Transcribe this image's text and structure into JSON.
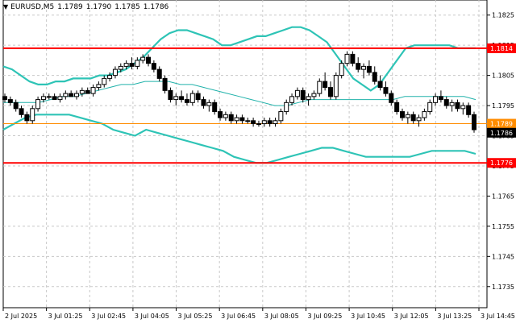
{
  "header": {
    "symbol": "EURUSD,M5",
    "bid_open": "1.1789",
    "bid_high": "1.1790",
    "bid_low": "1.1785",
    "bid_close": "1.1786"
  },
  "colors": {
    "background": "#ffffff",
    "candle": "#000000",
    "bands": "#2ec4b6",
    "ma": "#20b2aa",
    "resistance": "#ff0000",
    "support": "#ff0000",
    "marker": "#ff8c00",
    "grid": "#c8c8c8",
    "price_tag_dark": "#000000"
  },
  "chart_data": {
    "type": "candlestick",
    "ylim": [
      1.1728,
      1.183
    ],
    "y_ticks": [
      "1.1825",
      "1.1815",
      "1.1805",
      "1.1795",
      "1.1785",
      "1.1775",
      "1.1765",
      "1.1755",
      "1.1745",
      "1.1735"
    ],
    "x_labels": [
      "2 Jul 2025",
      "3 Jul 01:25",
      "3 Jul 02:45",
      "3 Jul 04:05",
      "3 Jul 05:25",
      "3 Jul 06:45",
      "3 Jul 08:05",
      "3 Jul 09:25",
      "3 Jul 10:45",
      "3 Jul 12:05",
      "3 Jul 13:25",
      "3 Jul 14:45"
    ],
    "grid": true,
    "levels": [
      {
        "name": "resistance",
        "value": 1.1814,
        "label": "1.1814",
        "color": "#ff0000"
      },
      {
        "name": "marker",
        "value": 1.1789,
        "label": "1.1789",
        "color": "#ff8c00"
      },
      {
        "name": "support",
        "value": 1.1776,
        "label": "1.1776",
        "color": "#ff0000"
      }
    ],
    "current_price": {
      "value": 1.1786,
      "label": "1.1786"
    },
    "candles": [
      [
        1.1798,
        1.1799,
        1.1796,
        1.1797
      ],
      [
        1.1797,
        1.1798,
        1.1795,
        1.1796
      ],
      [
        1.1796,
        1.1797,
        1.1793,
        1.1794
      ],
      [
        1.1794,
        1.1795,
        1.1791,
        1.1792
      ],
      [
        1.1792,
        1.1793,
        1.1789,
        1.179
      ],
      [
        1.179,
        1.1795,
        1.1789,
        1.1794
      ],
      [
        1.1794,
        1.1798,
        1.1793,
        1.1797
      ],
      [
        1.1797,
        1.1799,
        1.1796,
        1.1798
      ],
      [
        1.1798,
        1.1799,
        1.1797,
        1.1798
      ],
      [
        1.1798,
        1.1799,
        1.1797,
        1.1797
      ],
      [
        1.1797,
        1.1799,
        1.1796,
        1.1798
      ],
      [
        1.1798,
        1.18,
        1.1797,
        1.1799
      ],
      [
        1.1799,
        1.18,
        1.1798,
        1.1798
      ],
      [
        1.1798,
        1.18,
        1.1797,
        1.1799
      ],
      [
        1.1799,
        1.1801,
        1.1798,
        1.18
      ],
      [
        1.18,
        1.1801,
        1.1799,
        1.1799
      ],
      [
        1.1799,
        1.1802,
        1.1798,
        1.1801
      ],
      [
        1.1801,
        1.1803,
        1.18,
        1.1802
      ],
      [
        1.1802,
        1.1805,
        1.1801,
        1.1804
      ],
      [
        1.1804,
        1.1806,
        1.1803,
        1.1805
      ],
      [
        1.1805,
        1.1808,
        1.1804,
        1.1807
      ],
      [
        1.1807,
        1.1809,
        1.1806,
        1.1808
      ],
      [
        1.1808,
        1.181,
        1.1807,
        1.1809
      ],
      [
        1.1809,
        1.1811,
        1.1807,
        1.1808
      ],
      [
        1.1808,
        1.1811,
        1.1807,
        1.181
      ],
      [
        1.181,
        1.1812,
        1.1809,
        1.1811
      ],
      [
        1.1811,
        1.1812,
        1.1808,
        1.1809
      ],
      [
        1.1809,
        1.181,
        1.1806,
        1.1807
      ],
      [
        1.1807,
        1.1808,
        1.1803,
        1.1804
      ],
      [
        1.1804,
        1.1805,
        1.1799,
        1.18
      ],
      [
        1.18,
        1.1801,
        1.1796,
        1.1797
      ],
      [
        1.1797,
        1.1799,
        1.1795,
        1.1798
      ],
      [
        1.1798,
        1.18,
        1.1796,
        1.1797
      ],
      [
        1.1797,
        1.1799,
        1.1795,
        1.1796
      ],
      [
        1.1796,
        1.18,
        1.1795,
        1.1799
      ],
      [
        1.1799,
        1.18,
        1.1796,
        1.1797
      ],
      [
        1.1797,
        1.1798,
        1.1794,
        1.1795
      ],
      [
        1.1795,
        1.1797,
        1.1793,
        1.1796
      ],
      [
        1.1796,
        1.1797,
        1.1792,
        1.1793
      ],
      [
        1.1793,
        1.1794,
        1.179,
        1.1791
      ],
      [
        1.1791,
        1.1793,
        1.179,
        1.1792
      ],
      [
        1.1792,
        1.1793,
        1.1789,
        1.179
      ],
      [
        1.179,
        1.1792,
        1.1789,
        1.1791
      ],
      [
        1.1791,
        1.1792,
        1.1789,
        1.179
      ],
      [
        1.179,
        1.1791,
        1.1789,
        1.179
      ],
      [
        1.179,
        1.1791,
        1.1788,
        1.1789
      ],
      [
        1.1789,
        1.179,
        1.1788,
        1.1789
      ],
      [
        1.1789,
        1.1791,
        1.1788,
        1.179
      ],
      [
        1.179,
        1.1791,
        1.1788,
        1.1789
      ],
      [
        1.1789,
        1.1791,
        1.1788,
        1.179
      ],
      [
        1.179,
        1.1794,
        1.1789,
        1.1793
      ],
      [
        1.1793,
        1.1797,
        1.1792,
        1.1796
      ],
      [
        1.1796,
        1.1799,
        1.1795,
        1.1798
      ],
      [
        1.1798,
        1.1801,
        1.1797,
        1.18
      ],
      [
        1.18,
        1.1801,
        1.1796,
        1.1797
      ],
      [
        1.1797,
        1.1799,
        1.1795,
        1.1798
      ],
      [
        1.1798,
        1.18,
        1.1797,
        1.1799
      ],
      [
        1.1799,
        1.1804,
        1.1798,
        1.1803
      ],
      [
        1.1803,
        1.1806,
        1.18,
        1.1801
      ],
      [
        1.1801,
        1.1803,
        1.1797,
        1.1798
      ],
      [
        1.1798,
        1.1806,
        1.1797,
        1.1805
      ],
      [
        1.1805,
        1.181,
        1.1804,
        1.1809
      ],
      [
        1.1809,
        1.1813,
        1.1808,
        1.1812
      ],
      [
        1.1812,
        1.1813,
        1.1808,
        1.1809
      ],
      [
        1.1809,
        1.1811,
        1.1806,
        1.1807
      ],
      [
        1.1807,
        1.1809,
        1.1804,
        1.1808
      ],
      [
        1.1808,
        1.181,
        1.1805,
        1.1806
      ],
      [
        1.1806,
        1.1808,
        1.1802,
        1.1803
      ],
      [
        1.1803,
        1.1805,
        1.18,
        1.1801
      ],
      [
        1.1801,
        1.1803,
        1.1798,
        1.1799
      ],
      [
        1.1799,
        1.18,
        1.1795,
        1.1796
      ],
      [
        1.1796,
        1.1797,
        1.1792,
        1.1793
      ],
      [
        1.1793,
        1.1794,
        1.179,
        1.1791
      ],
      [
        1.1791,
        1.1793,
        1.1789,
        1.1792
      ],
      [
        1.1792,
        1.1793,
        1.1789,
        1.179
      ],
      [
        1.179,
        1.1792,
        1.1788,
        1.1791
      ],
      [
        1.1791,
        1.1794,
        1.179,
        1.1793
      ],
      [
        1.1793,
        1.1797,
        1.1792,
        1.1796
      ],
      [
        1.1796,
        1.1799,
        1.1795,
        1.1798
      ],
      [
        1.1798,
        1.18,
        1.1796,
        1.1797
      ],
      [
        1.1797,
        1.1798,
        1.1794,
        1.1795
      ],
      [
        1.1795,
        1.1797,
        1.1793,
        1.1796
      ],
      [
        1.1796,
        1.1797,
        1.1793,
        1.1794
      ],
      [
        1.1794,
        1.1796,
        1.1792,
        1.1795
      ],
      [
        1.1795,
        1.1796,
        1.1791,
        1.1792
      ],
      [
        1.1792,
        1.1793,
        1.1786,
        1.1787
      ]
    ],
    "upper_band": [
      1.1808,
      1.1807,
      1.1805,
      1.1803,
      1.1802,
      1.1802,
      1.1803,
      1.1803,
      1.1804,
      1.1804,
      1.1804,
      1.1805,
      1.1805,
      1.1806,
      1.1807,
      1.1809,
      1.1811,
      1.1814,
      1.1817,
      1.1819,
      1.182,
      1.182,
      1.1819,
      1.1818,
      1.1817,
      1.1815,
      1.1815,
      1.1816,
      1.1817,
      1.1818,
      1.1818,
      1.1819,
      1.182,
      1.1821,
      1.1821,
      1.182,
      1.1818,
      1.1816,
      1.1812,
      1.1808,
      1.1804,
      1.1802,
      1.18,
      1.1802,
      1.1806,
      1.181,
      1.1814,
      1.1815,
      1.1815,
      1.1815,
      1.1815,
      1.1815,
      1.1814,
      1.1814,
      1.1814
    ],
    "ma": [
      1.1796,
      1.1796,
      1.1796,
      1.1796,
      1.1797,
      1.1798,
      1.1798,
      1.1799,
      1.18,
      1.1801,
      1.1802,
      1.1802,
      1.1803,
      1.1803,
      1.1803,
      1.1802,
      1.1802,
      1.1801,
      1.18,
      1.1799,
      1.1798,
      1.1797,
      1.1796,
      1.1795,
      1.1795,
      1.1796,
      1.1797,
      1.1797,
      1.1797,
      1.1797,
      1.1797,
      1.1797,
      1.1797,
      1.1797,
      1.1798,
      1.1798,
      1.1798,
      1.1798,
      1.1798,
      1.1798,
      1.1797
    ],
    "lower_band": [
      1.1787,
      1.1789,
      1.1791,
      1.1792,
      1.1792,
      1.1792,
      1.1792,
      1.1791,
      1.179,
      1.1789,
      1.1787,
      1.1786,
      1.1785,
      1.1787,
      1.1786,
      1.1785,
      1.1784,
      1.1783,
      1.1782,
      1.1781,
      1.178,
      1.1778,
      1.1777,
      1.1776,
      1.1776,
      1.1777,
      1.1778,
      1.1779,
      1.178,
      1.1781,
      1.1781,
      1.178,
      1.1779,
      1.1778,
      1.1778,
      1.1778,
      1.1778,
      1.1778,
      1.1779,
      1.178,
      1.178,
      1.178,
      1.178,
      1.1779
    ]
  }
}
